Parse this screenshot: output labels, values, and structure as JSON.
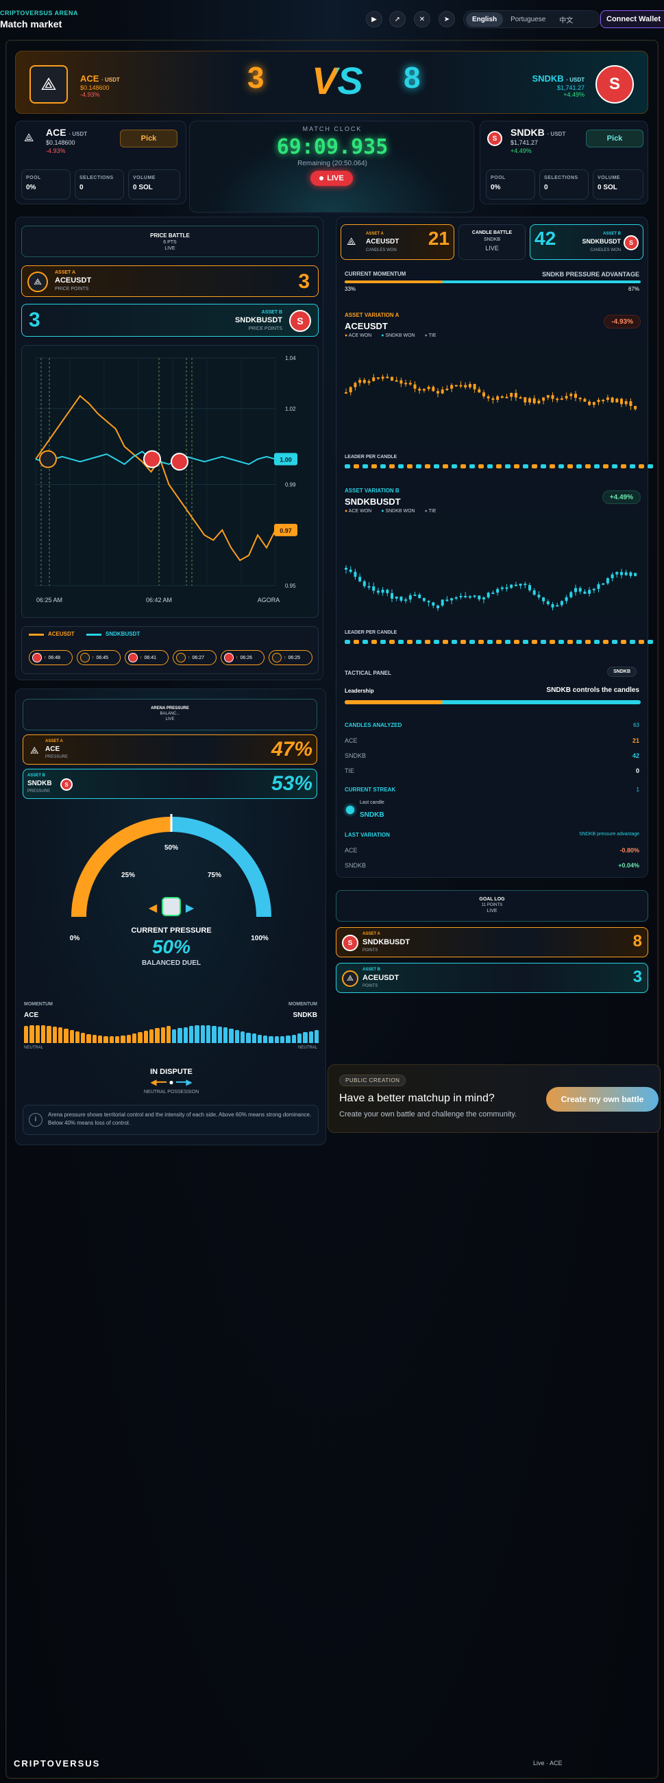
{
  "header": {
    "brand": "CRIPTOVERSUS ARENA",
    "page_title": "Match market",
    "languages": [
      "English",
      "Portuguese",
      "中文"
    ],
    "active_language": "English",
    "wallet_label": "Connect Wallet",
    "social_icons": [
      "youtube-icon",
      "rocket-icon",
      "x-icon",
      "telegram-icon"
    ]
  },
  "hero": {
    "ace_name": "ACE",
    "ace_pair": "· USDT",
    "ace_price": "$0.148600",
    "ace_change": "-4.93%",
    "ace_score": "3",
    "vs": "VS",
    "sndkb_score": "8",
    "sndkb_name": "SNDKB",
    "sndkb_pair": "· USDT",
    "sndkb_price": "$1,741.27",
    "sndkb_change": "+4.49%"
  },
  "ace_card": {
    "name": "ACE",
    "pair": "· USDT",
    "price": "$0.148600",
    "change": "-4.93%",
    "pick": "Pick",
    "pool_label": "POOL",
    "pool": "0%",
    "sel_label": "SELECTIONS",
    "sel": "0",
    "vol_label": "VOLUME",
    "vol": "0 SOL"
  },
  "sndkb_card": {
    "name": "SNDKB",
    "pair": "· USDT",
    "price": "$1,741.27",
    "change": "+4.49%",
    "pick": "Pick",
    "pool_label": "POOL",
    "pool": "0%",
    "sel_label": "SELECTIONS",
    "sel": "0",
    "vol_label": "VOLUME",
    "vol": "0 SOL"
  },
  "clock": {
    "label": "MATCH CLOCK",
    "time": "69:09.935",
    "remaining": "Remaining (20:50.064)",
    "live": "LIVE"
  },
  "price_battle": {
    "title": "PRICE BATTLE",
    "pts": "6 PTS",
    "status": "LIVE",
    "a_tag": "ASSET A",
    "a_name": "ACEUSDT",
    "a_sub": "PRICE POINTS",
    "a_score": "3",
    "b_tag": "ASSET B",
    "b_name": "SNDKBUSDT",
    "b_sub": "PRICE POINTS",
    "b_score": "3",
    "legend_a": "ACEUSDT",
    "legend_b": "SNDKBUSDT",
    "goals": [
      {
        "asset": "SNDKB",
        "time": "06:48"
      },
      {
        "asset": "ACE",
        "time": "06:45"
      },
      {
        "asset": "SNDKB",
        "time": "06:41"
      },
      {
        "asset": "ACE",
        "time": "06:27"
      },
      {
        "asset": "SNDKB",
        "time": "06:26"
      },
      {
        "asset": "ACE",
        "time": "06:25"
      }
    ]
  },
  "chart_data": {
    "type": "line",
    "x_ticks": [
      "06:25 AM",
      "06:42 AM",
      "AGORA"
    ],
    "ylim": [
      0.95,
      1.04
    ],
    "y_ticks": [
      "1.04",
      "1.02",
      "0.99",
      "0.95"
    ],
    "series": [
      {
        "name": "ACEUSDT",
        "color": "#ff9f1c",
        "values": [
          1.0,
          1.005,
          1.01,
          1.015,
          1.02,
          1.025,
          1.022,
          1.018,
          1.015,
          1.012,
          1.005,
          1.002,
          0.999,
          0.995,
          1.0,
          0.99,
          0.985,
          0.98,
          0.975,
          0.97,
          0.968,
          0.972,
          0.965,
          0.96,
          0.962,
          0.97,
          0.965,
          0.972
        ]
      },
      {
        "name": "SNDKBUSDT",
        "color": "#29d3e6",
        "values": [
          1.0,
          0.999,
          1.0,
          1.001,
          1.0,
          0.999,
          1.0,
          1.001,
          1.002,
          1.0,
          0.998,
          1.001,
          1.003,
          1.0,
          0.999,
          0.998,
          1.0,
          1.001,
          1.0,
          0.999,
          1.0,
          1.001,
          1.0,
          0.999,
          0.998,
          1.0,
          1.001,
          1.0
        ]
      }
    ],
    "last_labels": {
      "b": "1.00",
      "a": "0.97"
    }
  },
  "pressure": {
    "title": "ARENA PRESSURE",
    "sub": "BALANC...",
    "status": "LIVE",
    "a_tag": "ASSET A",
    "a_name": "ACE",
    "a_sub": "PRESSURE",
    "a_pct": "47%",
    "b_tag": "ASSET B",
    "b_name": "SNDKB",
    "b_sub": "PRESSURE",
    "b_pct": "53%",
    "gauge_value": 0.5,
    "gauge_labels": {
      "p0": "0%",
      "p25": "25%",
      "p50": "50%",
      "p75": "75%",
      "p100": "100%"
    },
    "current_label": "CURRENT PRESSURE",
    "current_value": "50%",
    "duel_label": "BALANCED DUEL",
    "momentum_label": "MOMENTUM",
    "momentum_a": "ACE",
    "momentum_b": "SNDKB",
    "neutral": "NEUTRAL",
    "dispute": "IN DISPUTE",
    "possession": "NEUTRAL POSSESSION",
    "info": "Arena pressure shows territorial control and the intensity of each side. Above 60% means strong dominance. Below 40% means loss of control."
  },
  "candle_battle": {
    "a_tag": "ASSET A",
    "a_name": "ACEUSDT",
    "a_sub": "CANDLES WON",
    "a_score": "21",
    "title": "CANDLE BATTLE",
    "subtitle": "SNDKB",
    "status": "LIVE",
    "b_tag": "ASSET B",
    "b_name": "SNDKBUSDT",
    "b_sub": "CANDLES WON",
    "b_score": "42",
    "momentum_label": "CURRENT MOMENTUM",
    "momentum_right": "SNDKB PRESSURE ADVANTAGE",
    "momentum_a": "33%",
    "momentum_b": "67%",
    "momentum_fraction_a": 0.33
  },
  "variation_a": {
    "tag": "ASSET VARIATION A",
    "name": "ACEUSDT",
    "change": "-4.93%",
    "legend": [
      "ACE WON",
      "SNDKB WON",
      "TIE"
    ],
    "leader_label": "LEADER PER CANDLE"
  },
  "variation_b": {
    "tag": "ASSET VARIATION B",
    "name": "SNDKBUSDT",
    "change": "+4.49%",
    "legend": [
      "ACE WON",
      "SNDKB WON",
      "TIE"
    ],
    "leader_label": "LEADER PER CANDLE"
  },
  "tactical": {
    "title": "TACTICAL PANEL",
    "badge": "SNDKB",
    "leadership_label": "Leadership",
    "leadership_value": "SNDKB controls the candles",
    "leadership_fraction_a": 0.33,
    "analyzed_label": "CANDLES ANALYZED",
    "analyzed": "63",
    "ace_label": "ACE",
    "ace_count": "21",
    "sndkb_label": "SNDKB",
    "sndkb_count": "42",
    "tie_label": "TIE",
    "tie_count": "0",
    "streak_label": "CURRENT STREAK",
    "streak": "1",
    "last_candle_label": "Last candle",
    "last_candle": "SNDKB",
    "last_var_label": "LAST VARIATION",
    "last_var_right": "SNDKB pressure advantage",
    "ace_var": "-0.80%",
    "sndkb_var": "+0.04%"
  },
  "goal_log": {
    "title": "GOAL LOG",
    "points": "11 POINTS",
    "status": "LIVE",
    "b_tag": "ASSET A",
    "b_name": "SNDKBUSDT",
    "b_sub": "POINTS",
    "b_score": "8",
    "a_tag": "ASSET B",
    "a_name": "ACEUSDT",
    "a_sub": "POINTS",
    "a_score": "3"
  },
  "creation": {
    "badge": "PUBLIC CREATION",
    "title": "Have a better matchup in mind?",
    "text": "Create your own battle and challenge the community.",
    "button": "Create my own battle"
  },
  "footer": {
    "brand": "CRIPTOVERSUS",
    "right": "Live · ACE"
  },
  "colors": {
    "ace": "#ff9f1c",
    "sndkb": "#29d3e6",
    "live": "#e5333b",
    "clock": "#2ee37a"
  }
}
